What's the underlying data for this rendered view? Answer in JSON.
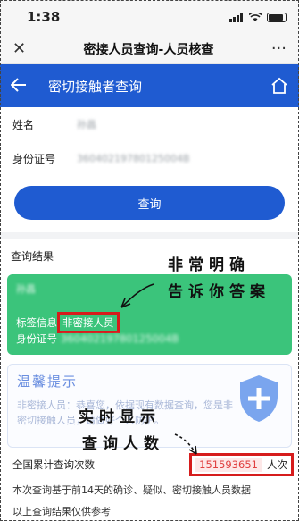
{
  "status": {
    "time": "1:38"
  },
  "wechat": {
    "close_icon": "close-icon",
    "title": "密接人员查询-人员核查",
    "more_label": "···"
  },
  "header": {
    "back_icon": "arrow-left-icon",
    "title": "密切接触者查询",
    "home_icon": "home-icon"
  },
  "form": {
    "name_label": "姓名",
    "name_value": "孙昌",
    "id_label": "身份证号",
    "id_value": "36040219780125004B"
  },
  "query_button": "查询",
  "results": {
    "section_title": "查询结果",
    "name": "孙昌",
    "tag_label": "标签信息",
    "tag_value": "非密接人员",
    "id_label": "身份证号",
    "id_value": "36040219780125004B"
  },
  "tips": {
    "title": "温馨提示",
    "text": "非密接人员：恭喜您，依据现有数据查询，您是非密切接触人员，请做好个人防护。"
  },
  "stats": {
    "label": "全国累计查询次数",
    "count": "151593651",
    "unit": "人次",
    "note1": "本次查询基于前14天的确诊、疑似、密切接触人员数据",
    "note2": "以上查询结果仅供参考"
  },
  "annotations": {
    "line1": "非常明确",
    "line2": "告诉你答案",
    "line3": "实时显示",
    "line4": "查询人数"
  },
  "colors": {
    "primary": "#1f5bd1",
    "result_green": "#3bc47b",
    "highlight_red": "#d61c1c"
  }
}
